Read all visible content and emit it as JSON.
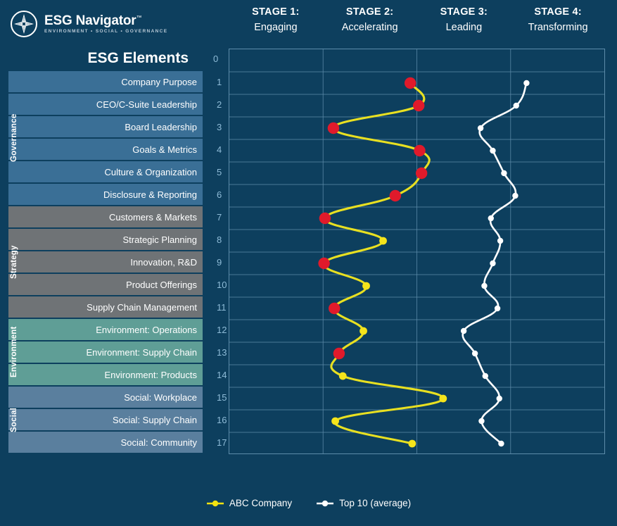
{
  "brand": {
    "title": "ESG Navigator",
    "tm": "™",
    "tagline": "ENVIRONMENT • SOCIAL • GOVERNANCE",
    "icon": "compass-star-icon"
  },
  "header": {
    "elements_title": "ESG Elements",
    "elements_index": "0",
    "stages": [
      {
        "top": "STAGE 1:",
        "sub": "Engaging"
      },
      {
        "top": "STAGE 2:",
        "sub": "Accelerating"
      },
      {
        "top": "STAGE 3:",
        "sub": "Leading"
      },
      {
        "top": "STAGE 4:",
        "sub": "Transforming"
      }
    ]
  },
  "categories": [
    {
      "name": "Governance",
      "color": "#3a6f96",
      "rows": [
        1,
        2,
        3,
        4,
        5,
        6
      ]
    },
    {
      "name": "Strategy",
      "color": "#6f7376",
      "rows": [
        7,
        8,
        9,
        10,
        11
      ]
    },
    {
      "name": "Environment",
      "color": "#5f9e96",
      "rows": [
        12,
        13,
        14
      ]
    },
    {
      "name": "Social",
      "color": "#5a7f9e",
      "rows": [
        15,
        16,
        17
      ]
    }
  ],
  "elements": [
    {
      "num": "1",
      "label": "Company Purpose",
      "category": "governance"
    },
    {
      "num": "2",
      "label": "CEO/C-Suite Leadership",
      "category": "governance"
    },
    {
      "num": "3",
      "label": "Board Leadership",
      "category": "governance"
    },
    {
      "num": "4",
      "label": "Goals & Metrics",
      "category": "governance"
    },
    {
      "num": "5",
      "label": "Culture & Organization",
      "category": "governance"
    },
    {
      "num": "6",
      "label": "Disclosure & Reporting",
      "category": "governance"
    },
    {
      "num": "7",
      "label": "Customers & Markets",
      "category": "strategy"
    },
    {
      "num": "8",
      "label": "Strategic Planning",
      "category": "strategy"
    },
    {
      "num": "9",
      "label": "Innovation, R&D",
      "category": "strategy"
    },
    {
      "num": "10",
      "label": "Product Offerings",
      "category": "strategy"
    },
    {
      "num": "11",
      "label": "Supply Chain Management",
      "category": "strategy"
    },
    {
      "num": "12",
      "label": "Environment: Operations",
      "category": "environment"
    },
    {
      "num": "13",
      "label": "Environment: Supply Chain",
      "category": "environment"
    },
    {
      "num": "14",
      "label": "Environment: Products",
      "category": "environment"
    },
    {
      "num": "15",
      "label": "Social: Workplace",
      "category": "social"
    },
    {
      "num": "16",
      "label": "Social: Supply Chain",
      "category": "social"
    },
    {
      "num": "17",
      "label": "Social: Community",
      "category": "social"
    }
  ],
  "legend": {
    "items": [
      {
        "label": "ABC Company",
        "color": "#f2e210",
        "marker": "yellow-dot-marker"
      },
      {
        "label": "Top 10 (average)",
        "color": "#ffffff",
        "marker": "white-dot-marker"
      }
    ]
  },
  "colors": {
    "background": "#0d3f5e",
    "plot_background": "#0d4663",
    "gridline": "#5d8caa",
    "company_line": "#e8e021",
    "company_marker": "#f5e41b",
    "company_marker_alert": "#e01a2b",
    "benchmark_line": "#ffffff",
    "benchmark_marker": "#ffffff",
    "row_number": "#8fbcd8"
  },
  "chart_data": {
    "type": "line",
    "title": "ESG Elements maturity by stage",
    "orientation": "horizontal-value-vertical-category",
    "xlabel": "",
    "ylabel": "ESG Elements",
    "xlim": [
      1,
      5
    ],
    "x_axis_ticks": [
      "STAGE 1: Engaging",
      "STAGE 2: Accelerating",
      "STAGE 3: Leading",
      "STAGE 4: Transforming"
    ],
    "grid": true,
    "legend_position": "bottom-center",
    "categories": [
      "Company Purpose",
      "CEO/C-Suite Leadership",
      "Board Leadership",
      "Goals & Metrics",
      "Culture & Organization",
      "Disclosure & Reporting",
      "Customers & Markets",
      "Strategic Planning",
      "Innovation, R&D",
      "Product Offerings",
      "Supply Chain Management",
      "Environment: Operations",
      "Environment: Supply Chain",
      "Environment: Products",
      "Social: Workplace",
      "Social: Supply Chain",
      "Social: Community"
    ],
    "series": [
      {
        "name": "ABC Company",
        "color": "#f2e210",
        "values": [
          2.93,
          3.02,
          2.11,
          3.03,
          3.05,
          2.77,
          2.02,
          2.64,
          2.01,
          2.46,
          2.12,
          2.43,
          2.17,
          2.21,
          3.28,
          2.13,
          2.95
        ],
        "marker_flags": [
          "alert",
          "alert",
          "alert",
          "alert",
          "alert",
          "alert",
          "alert",
          "normal",
          "alert",
          "normal",
          "alert",
          "normal",
          "alert",
          "normal",
          "normal",
          "normal",
          "normal"
        ]
      },
      {
        "name": "Top 10 (average)",
        "color": "#ffffff",
        "values": [
          4.17,
          4.06,
          3.68,
          3.81,
          3.93,
          4.05,
          3.79,
          3.89,
          3.81,
          3.72,
          3.86,
          3.5,
          3.62,
          3.73,
          3.88,
          3.69,
          3.9
        ]
      }
    ]
  }
}
